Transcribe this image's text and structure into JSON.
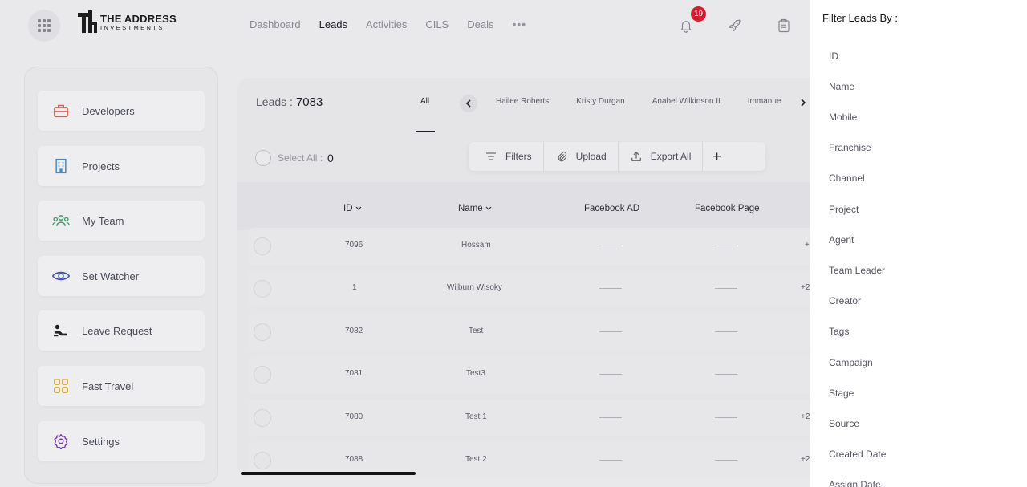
{
  "brand": {
    "line1": "THE ADDRESS",
    "line2": "INVESTMENTS"
  },
  "nav": {
    "items": [
      "Dashboard",
      "Leads",
      "Activities",
      "CILS",
      "Deals"
    ],
    "active": "Leads",
    "more": "•••"
  },
  "notifications": {
    "count": "19"
  },
  "sidebar": {
    "items": [
      {
        "label": "Developers",
        "icon": "briefcase-icon",
        "color": "#e0674f"
      },
      {
        "label": "Projects",
        "icon": "building-icon",
        "color": "#4a90c8"
      },
      {
        "label": "My Team",
        "icon": "team-icon",
        "color": "#3aa36a"
      },
      {
        "label": "Set Watcher",
        "icon": "eye-icon",
        "color": "#3b55b0"
      },
      {
        "label": "Leave Request",
        "icon": "leave-icon",
        "color": "#1f1f1f"
      },
      {
        "label": "Fast Travel",
        "icon": "grid-icon",
        "color": "#e2b53a"
      },
      {
        "label": "Settings",
        "icon": "gear-icon",
        "color": "#7b3db0"
      }
    ]
  },
  "leads": {
    "label": "Leads :",
    "count": "7083",
    "tab_all": "All",
    "agents": [
      "Hailee Roberts",
      "Kristy Durgan",
      "Anabel Wilkinson II",
      "Immanue"
    ],
    "select_all_label": "Select All :",
    "selected_count": "0"
  },
  "toolbar": {
    "filters": "Filters",
    "upload": "Upload",
    "export_all": "Export All",
    "add": "+"
  },
  "table": {
    "columns": [
      "ID",
      "Name",
      "Facebook AD",
      "Facebook Page"
    ],
    "rows": [
      {
        "id": "7096",
        "name": "Hossam",
        "extra": "+"
      },
      {
        "id": "1",
        "name": "Wilburn Wisoky",
        "extra": "+2"
      },
      {
        "id": "7082",
        "name": "Test",
        "extra": ""
      },
      {
        "id": "7081",
        "name": "Test3",
        "extra": ""
      },
      {
        "id": "7080",
        "name": "Test 1",
        "extra": "+2"
      },
      {
        "id": "7088",
        "name": "Test 2",
        "extra": "+2"
      }
    ]
  },
  "filter_drawer": {
    "title": "Filter Leads By :",
    "items": [
      "ID",
      "Name",
      "Mobile",
      "Franchise",
      "Channel",
      "Project",
      "Agent",
      "Team Leader",
      "Creator",
      "Tags",
      "Campaign",
      "Stage",
      "Source",
      "Created Date",
      "Assign Date"
    ]
  }
}
